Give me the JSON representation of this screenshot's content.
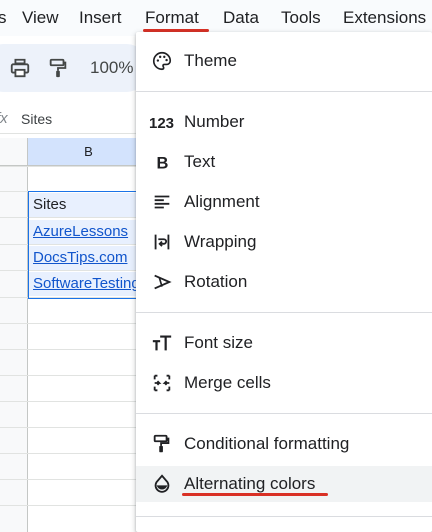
{
  "menubar": {
    "items": [
      {
        "label": "s"
      },
      {
        "label": "View"
      },
      {
        "label": "Insert"
      },
      {
        "label": "Format"
      },
      {
        "label": "Data"
      },
      {
        "label": "Tools"
      },
      {
        "label": "Extensions"
      }
    ],
    "active": "Format"
  },
  "toolbar": {
    "zoom": "100%",
    "icons": [
      "print-icon",
      "paint-format-icon"
    ]
  },
  "formula_bar": {
    "fx": "fx",
    "value": "Sites"
  },
  "grid": {
    "column_header": "B",
    "cells": [
      "Sites",
      "AzureLessons",
      "DocsTips.com",
      "SoftwareTesting"
    ]
  },
  "format_menu": {
    "items": [
      {
        "label": "Theme",
        "icon": "palette-icon"
      },
      {
        "label": "Number",
        "icon": "number-123-icon"
      },
      {
        "label": "Text",
        "icon": "bold-b-icon"
      },
      {
        "label": "Alignment",
        "icon": "align-left-icon"
      },
      {
        "label": "Wrapping",
        "icon": "wrap-text-icon"
      },
      {
        "label": "Rotation",
        "icon": "text-rotation-icon"
      },
      {
        "label": "Font size",
        "icon": "font-size-icon"
      },
      {
        "label": "Merge cells",
        "icon": "merge-cells-icon"
      },
      {
        "label": "Conditional formatting",
        "icon": "paint-roller-icon"
      },
      {
        "label": "Alternating colors",
        "icon": "drop-icon"
      }
    ],
    "highlighted": "Alternating colors"
  },
  "annotation_color": "#d93025"
}
